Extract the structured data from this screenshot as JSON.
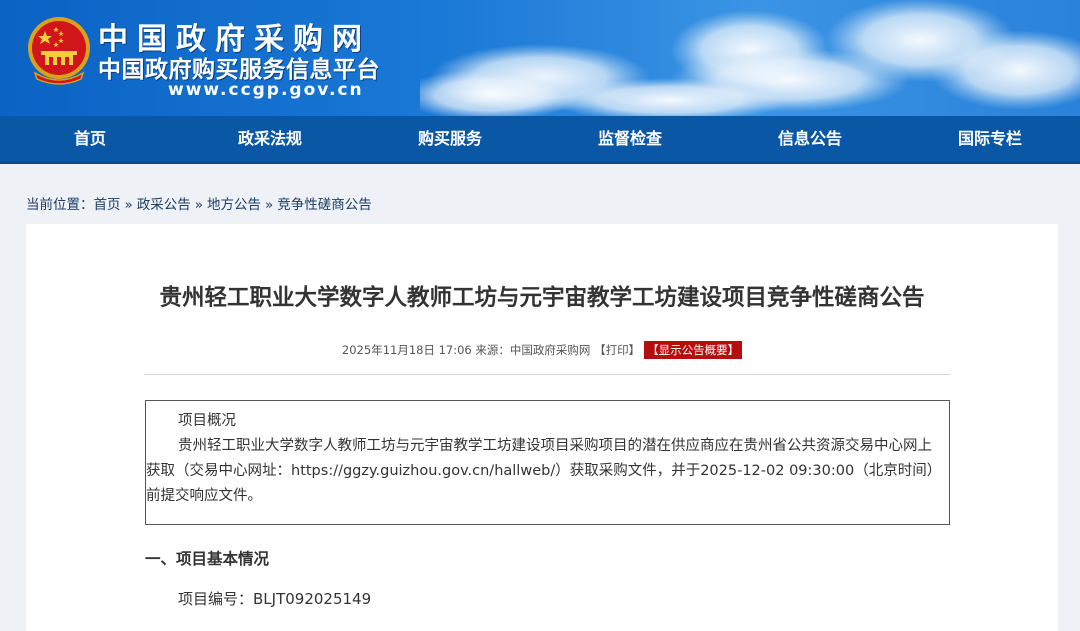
{
  "header": {
    "site_title": "中国政府采购网",
    "site_subtitle": "中国政府购买服务信息平台",
    "site_url": "www.ccgp.gov.cn",
    "emblem_icon": "national-emblem-icon",
    "colors": {
      "banner_blue": "#1a78d6",
      "nav_blue": "#0a57a6"
    }
  },
  "nav": {
    "items": [
      {
        "label": "首页"
      },
      {
        "label": "政采法规"
      },
      {
        "label": "购买服务"
      },
      {
        "label": "监督检查"
      },
      {
        "label": "信息公告"
      },
      {
        "label": "国际专栏"
      }
    ]
  },
  "breadcrumb": {
    "prefix": "当前位置：",
    "items": [
      "首页",
      "政采公告",
      "地方公告",
      "竞争性磋商公告"
    ],
    "separator": "»"
  },
  "article": {
    "title": "贵州轻工职业大学数字人教师工坊与元宇宙教学工坊建设项目竞争性磋商公告",
    "meta": {
      "datetime": "2025年11月18日 17:06",
      "source_label": "来源：",
      "source": "中国政府采购网",
      "print_label": "【打印】",
      "summary_label": "【显示公告概要】",
      "summary_color": "#b40f0f"
    },
    "overview": {
      "title": "项目概况",
      "body": "贵州轻工职业大学数字人教师工坊与元宇宙教学工坊建设项目采购项目的潜在供应商应在贵州省公共资源交易中心网上获取（交易中心网址：https://ggzy.guizhou.gov.cn/hallweb/）获取采购文件，并于2025-12-02 09:30:00（北京时间）前提交响应文件。"
    },
    "section_1": {
      "heading": "一、项目基本情况",
      "project_number_label": "项目编号：",
      "project_number": "BLJT092025149"
    }
  }
}
